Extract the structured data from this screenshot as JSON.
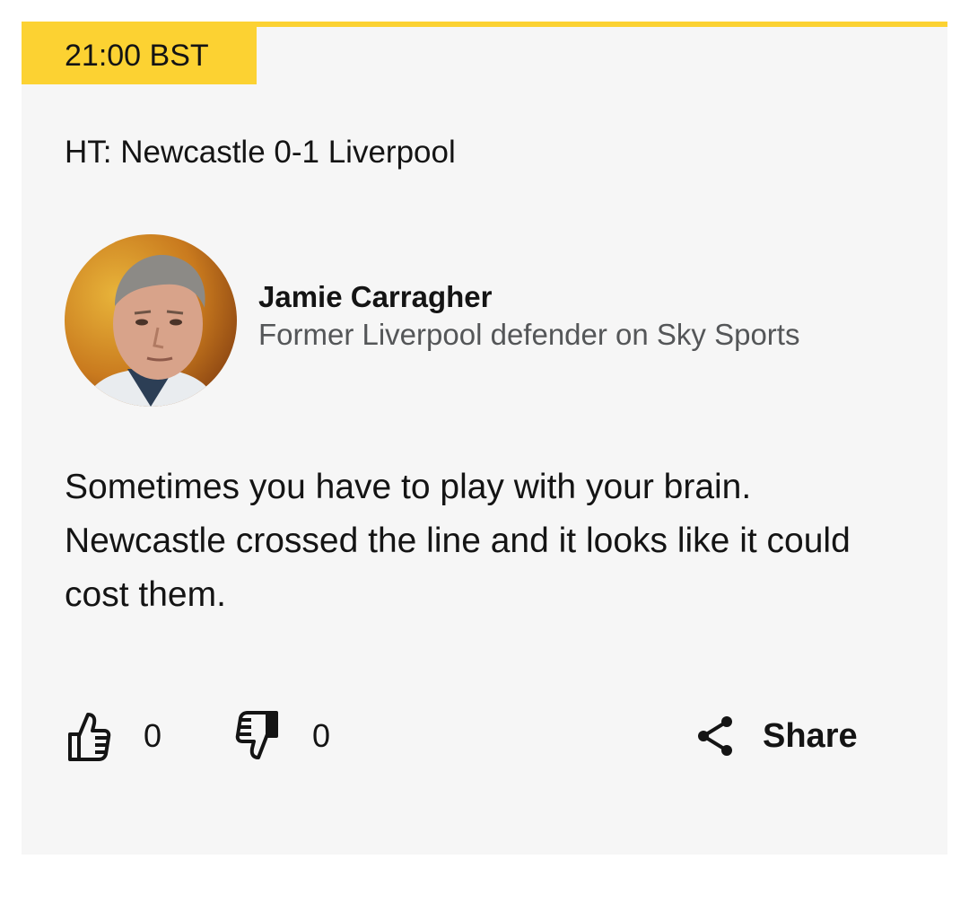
{
  "post": {
    "time": "21:00 BST",
    "headline": "HT: Newcastle 0-1 Liverpool",
    "contributor": {
      "name": "Jamie Carragher",
      "role": "Former Liverpool defender on Sky Sports",
      "avatar_icon": "contributor-photo"
    },
    "quote": "Sometimes you have to play with your brain. Newcastle crossed the line and it looks like it could cost them.",
    "actions": {
      "like_count": "0",
      "dislike_count": "0",
      "share_label": "Share",
      "like_icon": "thumbs-up-icon",
      "dislike_icon": "thumbs-down-icon",
      "share_icon": "share-icon"
    }
  },
  "colors": {
    "accent": "#fcd232",
    "card_background": "#f6f6f6",
    "text_primary": "#141414",
    "text_secondary": "#545658"
  }
}
